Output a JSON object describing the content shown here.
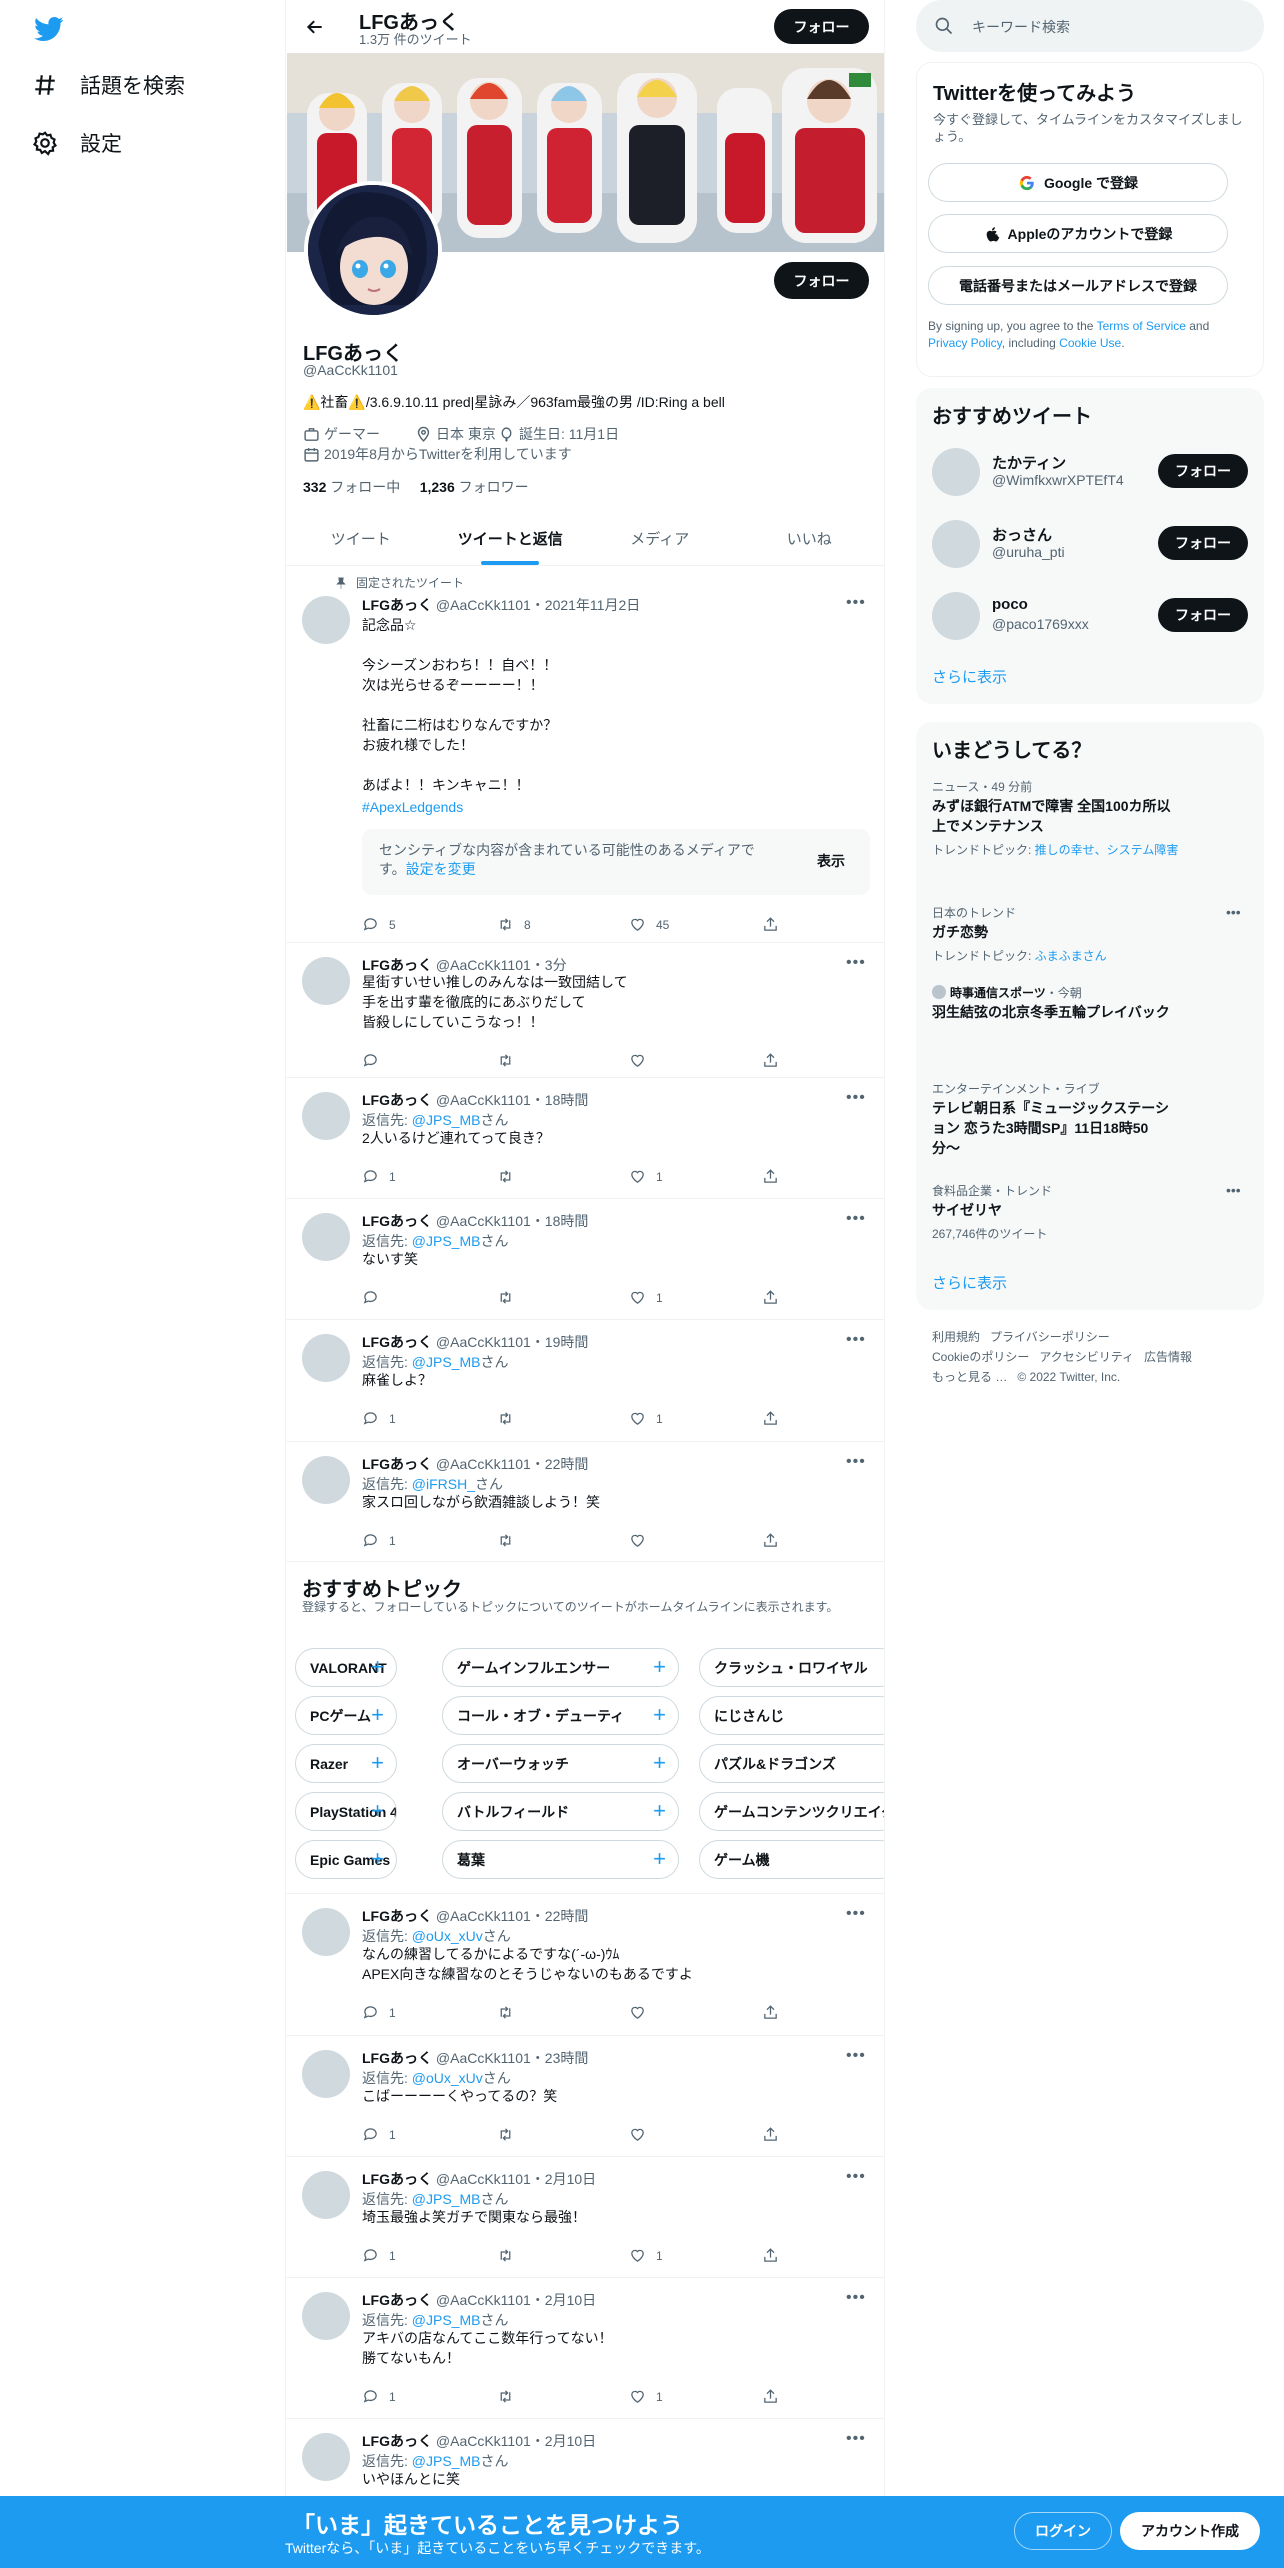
{
  "nav": {
    "explore_label": "話題を検索",
    "settings_label": "設定"
  },
  "topbar": {
    "name": "LFGあっく",
    "tweet_count": "1.3万 件のツイート",
    "follow_label": "フォロー"
  },
  "profile": {
    "name": "LFGあっく",
    "handle": "@AaCcKk1101",
    "bio": "⚠️社畜⚠️/3.6.9.10.11 pred|星詠み／963fam最強の男 /ID:Ring a bell",
    "category": "ゲーマー",
    "location": "日本 東京",
    "birthday": "誕生日: 11月1日",
    "joined": "2019年8月からTwitterを利用しています",
    "following_count": "332",
    "following_label": "フォロー中",
    "followers_count": "1,236",
    "followers_label": "フォロワー",
    "follow_label": "フォロー"
  },
  "tabs": [
    {
      "label": "ツイート"
    },
    {
      "label": "ツイートと返信"
    },
    {
      "label": "メディア"
    },
    {
      "label": "いいね"
    }
  ],
  "pinned_label": "固定されたツイート",
  "tweets": [
    {
      "name": "LFGあっく",
      "meta": "@AaCcKk1101・2021年11月2日",
      "text": "記念品☆\n\n今シーズンおわち！！自ベ！！\n次は光らせるぞーーーー！！\n\n社畜に二桁はむりなんですか？\nお疲れ様でした！\n\nあばよ！！キンキャニ！！",
      "hashtag": "#ApexLedgends",
      "sensitive": "センシティブな内容が含まれている可能性のあるメディアです。",
      "sensitive_link": "設定を変更",
      "show_label": "表示",
      "replies": "5",
      "retweets": "8",
      "likes": "45"
    },
    {
      "name": "LFGあっく",
      "meta": "@AaCcKk1101・3分",
      "text": "星街すいせい推しのみんなは一致団結して\n手を出す輩を徹底的にあぶりだして\n皆殺しにしていこうなっ！！",
      "replies": "",
      "retweets": "",
      "likes": ""
    },
    {
      "name": "LFGあっく",
      "meta": "@AaCcKk1101・18時間",
      "reply_prefix": "返信先: ",
      "reply_to": "@JPS_MB",
      "reply_suffix": "さん",
      "text": "2人いるけど連れてって良き？",
      "replies": "1",
      "retweets": "",
      "likes": "1"
    },
    {
      "name": "LFGあっく",
      "meta": "@AaCcKk1101・18時間",
      "reply_prefix": "返信先: ",
      "reply_to": "@JPS_MB",
      "reply_suffix": "さん",
      "text": "ないす笑",
      "replies": "",
      "retweets": "",
      "likes": "1"
    },
    {
      "name": "LFGあっく",
      "meta": "@AaCcKk1101・19時間",
      "reply_prefix": "返信先: ",
      "reply_to": "@JPS_MB",
      "reply_suffix": "さん",
      "text": "麻雀しよ？",
      "replies": "1",
      "retweets": "",
      "likes": "1"
    },
    {
      "name": "LFGあっく",
      "meta": "@AaCcKk1101・22時間",
      "reply_prefix": "返信先: ",
      "reply_to": "@iFRSH_",
      "reply_suffix": "さん",
      "text": "家スロ回しながら飲酒雑談しよう！笑",
      "replies": "1",
      "retweets": "",
      "likes": ""
    },
    {
      "name": "LFGあっく",
      "meta": "@AaCcKk1101・22時間",
      "reply_prefix": "返信先: ",
      "reply_to": "@oUx_xUv",
      "reply_suffix": "さん",
      "text": "なんの練習してるかによるですな(´-ω-)ｳﾑ\nAPEX向きな練習なのとそうじゃないのもあるですよ",
      "replies": "1",
      "retweets": "",
      "likes": ""
    },
    {
      "name": "LFGあっく",
      "meta": "@AaCcKk1101・23時間",
      "reply_prefix": "返信先: ",
      "reply_to": "@oUx_xUv",
      "reply_suffix": "さん",
      "text": "こばーーーーくやってるの？笑",
      "replies": "1",
      "retweets": "",
      "likes": ""
    },
    {
      "name": "LFGあっく",
      "meta": "@AaCcKk1101・2月10日",
      "reply_prefix": "返信先: ",
      "reply_to": "@JPS_MB",
      "reply_suffix": "さん",
      "text": "埼玉最強よ笑ガチで関東なら最強！",
      "replies": "1",
      "retweets": "",
      "likes": "1"
    },
    {
      "name": "LFGあっく",
      "meta": "@AaCcKk1101・2月10日",
      "reply_prefix": "返信先: ",
      "reply_to": "@JPS_MB",
      "reply_suffix": "さん",
      "text": "アキバの店なんてここ数年行ってない！\n勝てないもん！",
      "replies": "1",
      "retweets": "",
      "likes": "1"
    },
    {
      "name": "LFGあっく",
      "meta": "@AaCcKk1101・2月10日",
      "reply_prefix": "返信先: ",
      "reply_to": "@JPS_MB",
      "reply_suffix": "さん",
      "text": "いやほんとに笑"
    }
  ],
  "topics": {
    "title": "おすすめトピック",
    "subtitle": "登録すると、フォローしているトピックについてのツイートがホームタイムラインに表示されます。",
    "rows": [
      [
        "VALORANT",
        "ゲームインフルエンサー",
        "クラッシュ・ロワイヤル"
      ],
      [
        "PCゲーム",
        "コール・オブ・デューティ",
        "にじさんじ"
      ],
      [
        "Razer",
        "オーバーウォッチ",
        "パズル&ドラゴンズ"
      ],
      [
        "PlayStation 4",
        "バトルフィールド",
        "ゲームコンテンツクリエイター"
      ],
      [
        "Epic Games",
        "葛葉",
        "ゲーム機"
      ]
    ]
  },
  "search": {
    "placeholder": "キーワード検索"
  },
  "signup": {
    "title": "Twitterを使ってみよう",
    "subtitle": "今すぐ登録して、タイムラインをカスタマイズしましょう。",
    "google": "Google で登録",
    "apple": "Appleのアカウントで登録",
    "phone": "電話番号またはメールアドレスで登録",
    "legal_prefix": "By signing up, you agree to the ",
    "tos": "Terms of Service",
    "and": " and ",
    "privacy": "Privacy Policy",
    "including": ", including ",
    "cookie": "Cookie Use",
    "period": "."
  },
  "who": {
    "title": "おすすめツイート",
    "users": [
      {
        "name": "たかティン",
        "handle": "@WimfkxwrXPTEfT4"
      },
      {
        "name": "おっさん",
        "handle": "@uruha_pti"
      },
      {
        "name": "poco",
        "handle": "@paco1769xxx"
      }
    ],
    "follow_label": "フォロー",
    "more": "さらに表示"
  },
  "trends": {
    "title": "いまどうしてる？",
    "items": [
      {
        "context": "ニュース・49 分前",
        "title": "みずほ銀行ATMで障害 全国100カ所以上でメンテナンス",
        "sub_prefix": "トレンドトピック: ",
        "sub_link": "推しの幸せ、システム障害"
      },
      {
        "context": "日本のトレンド",
        "title": "ガチ恋勢",
        "sub_prefix": "トレンドトピック: ",
        "sub_link": "ふまふまさん"
      },
      {
        "context_bold": "時事通信スポーツ",
        "context": "・今朝",
        "title": "羽生結弦の北京冬季五輪プレイバック"
      },
      {
        "context": "エンターテインメント・ライブ",
        "title": "テレビ朝日系『ミュージックステーション 恋うた3時間SP』11日18時50分〜"
      },
      {
        "context": "食料品企業・トレンド",
        "title": "サイゼリヤ",
        "sub": "267,746件のツイート"
      }
    ],
    "more": "さらに表示"
  },
  "footer": {
    "links": [
      "利用規約",
      "プライバシーポリシー",
      "Cookieのポリシー",
      "アクセシビリティ",
      "広告情報",
      "もっと見る …",
      "© 2022 Twitter, Inc."
    ]
  },
  "bottombar": {
    "title": "「いま」起きていることを見つけよう",
    "subtitle": "Twitterなら、「いま」起きていることをいち早くチェックできます。",
    "login": "ログイン",
    "signup": "アカウント作成"
  },
  "colors": {
    "accent": "#1d9bf0",
    "dark": "#0f1419",
    "muted": "#536471"
  }
}
